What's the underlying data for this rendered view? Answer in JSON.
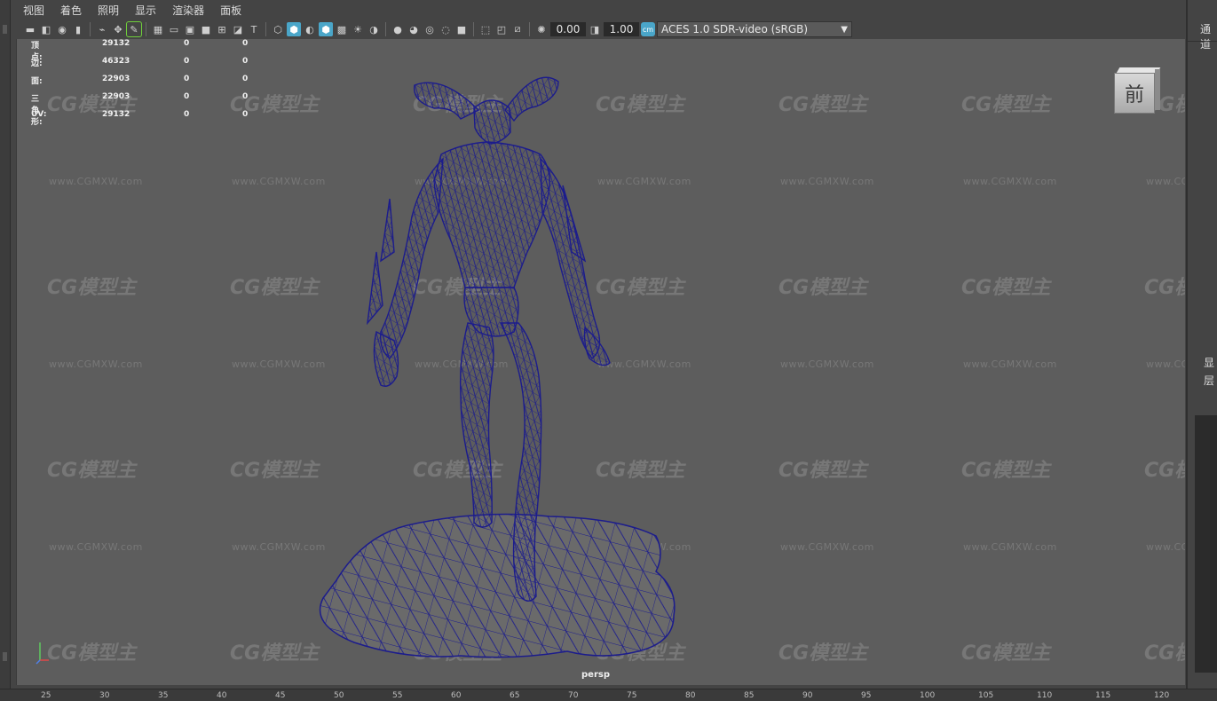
{
  "menu": [
    "视图",
    "着色",
    "照明",
    "显示",
    "渲染器",
    "面板"
  ],
  "toolbar": {
    "exposure_value": "0.00",
    "gamma_value": "1.00",
    "color_management_badge": "cm",
    "color_space": "ACES 1.0 SDR-video (sRGB)"
  },
  "hud": {
    "rows": [
      {
        "label": "顶点:",
        "v1": "29132",
        "v2": "0",
        "v3": "0"
      },
      {
        "label": "边:",
        "v1": "46323",
        "v2": "0",
        "v3": "0"
      },
      {
        "label": "面:",
        "v1": "22903",
        "v2": "0",
        "v3": "0"
      },
      {
        "label": "三角形:",
        "v1": "22903",
        "v2": "0",
        "v3": "0"
      },
      {
        "label": "UV:",
        "v1": "29132",
        "v2": "0",
        "v3": "0"
      }
    ]
  },
  "viewcube_label": "前",
  "camera_label": "persp",
  "watermark": {
    "logo": "CG模型主",
    "url": "www.CGMXW.com"
  },
  "right_panel": {
    "top_text": "通道",
    "mid_text_1": "显",
    "mid_text_2": "层"
  },
  "ruler": [
    "25",
    "30",
    "35",
    "40",
    "45",
    "50",
    "55",
    "60",
    "65",
    "70",
    "75",
    "80",
    "85",
    "90",
    "95",
    "100",
    "105",
    "110",
    "115",
    "120"
  ],
  "colors": {
    "wireframe": "#1c1c8c",
    "viewport_bg": "#5d5d5d",
    "accent": "#4aa6c9"
  }
}
